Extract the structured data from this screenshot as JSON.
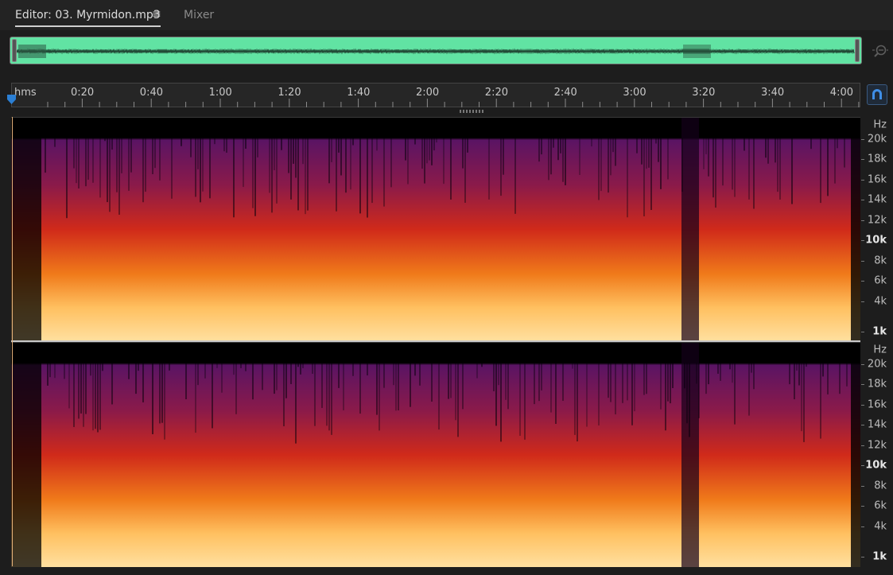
{
  "tabs": {
    "editor_label": "Editor: 03. Myrmidon.mp3",
    "menu_icon": "≡",
    "mixer_label": "Mixer"
  },
  "ruler": {
    "unit": "hms",
    "labels": [
      "0:20",
      "0:40",
      "1:00",
      "1:20",
      "1:40",
      "2:00",
      "2:20",
      "2:40",
      "3:00",
      "3:20",
      "3:40",
      "4:00"
    ]
  },
  "frequency_axis": {
    "unit": "Hz",
    "labels": [
      "20k",
      "18k",
      "16k",
      "14k",
      "12k",
      "10k",
      "8k",
      "6k",
      "4k",
      "1k"
    ]
  },
  "colors": {
    "overview_waveform": "#61e3a3",
    "accent": "#2b7fd4",
    "spectrogram_low": "#4a0f5a",
    "spectrogram_high": "#ffd27a"
  },
  "icons": {
    "zoom": "zoom-icon",
    "snap": "magnet-icon",
    "playhead": "playhead-marker-icon"
  }
}
